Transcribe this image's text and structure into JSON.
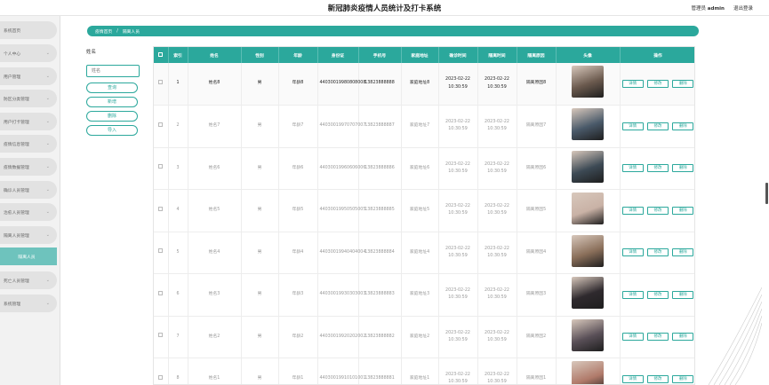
{
  "header": {
    "title": "新冠肺炎疫情人员统计及打卡系统",
    "user_label": "管理员",
    "user_name": "admin",
    "logout": "退出登录"
  },
  "sidebar": {
    "items": [
      {
        "label": "系统首页",
        "chevron": false
      },
      {
        "label": "个人中心",
        "chevron": true
      },
      {
        "label": "用户管理",
        "chevron": true
      },
      {
        "label": "防区分类管理",
        "chevron": true
      },
      {
        "label": "用户打卡管理",
        "chevron": true
      },
      {
        "label": "疫情信息管理",
        "chevron": true
      },
      {
        "label": "疫情数据管理",
        "chevron": true
      },
      {
        "label": "确诊人员管理",
        "chevron": true
      },
      {
        "label": "治愈人员管理",
        "chevron": true
      },
      {
        "label": "隔离人员管理",
        "chevron": true
      },
      {
        "label": "隔离人员",
        "chevron": false,
        "active": true
      },
      {
        "label": "死亡人员管理",
        "chevron": true
      },
      {
        "label": "系统管理",
        "chevron": true
      }
    ]
  },
  "breadcrumb": {
    "home": "疫情首页",
    "separator": "/",
    "current": "隔离人员"
  },
  "search": {
    "label": "姓名",
    "placeholder": "姓名",
    "buttons": [
      "查询",
      "新增",
      "删除",
      "导入"
    ]
  },
  "table": {
    "headers": [
      "索引",
      "姓名",
      "性别",
      "年龄",
      "身份证",
      "手机号",
      "家庭地址",
      "确诊时间",
      "隔离时间",
      "隔离原因",
      "头像",
      "操作"
    ],
    "row_actions": [
      "详情",
      "修改",
      "删除"
    ],
    "rows": [
      {
        "index": "1",
        "name": "姓名8",
        "gender": "男",
        "age": "年龄8",
        "id": "44030019980808008",
        "phone": "13823888888",
        "address": "家庭地址8",
        "confirm_time": "2023-02-22 10:30:59",
        "isolate_time": "2023-02-22 10:30:59",
        "reason": "隔离原因8",
        "avatar_color": "#6b5a4e"
      },
      {
        "index": "2",
        "name": "姓名7",
        "gender": "男",
        "age": "年龄7",
        "id": "44030019970707007",
        "phone": "13823888887",
        "address": "家庭地址7",
        "confirm_time": "2023-02-22 10:30:59",
        "isolate_time": "2023-02-22 10:30:59",
        "reason": "隔离原因7",
        "avatar_color": "#4a5a6a"
      },
      {
        "index": "3",
        "name": "姓名6",
        "gender": "男",
        "age": "年龄6",
        "id": "44030019960606006",
        "phone": "13823888886",
        "address": "家庭地址6",
        "confirm_time": "2023-02-22 10:30:59",
        "isolate_time": "2023-02-22 10:30:59",
        "reason": "隔离原因6",
        "avatar_color": "#3d4a55"
      },
      {
        "index": "4",
        "name": "姓名5",
        "gender": "男",
        "age": "年龄5",
        "id": "44030019950505005",
        "phone": "13823888885",
        "address": "家庭地址5",
        "confirm_time": "2023-02-22 10:30:59",
        "isolate_time": "2023-02-22 10:30:59",
        "reason": "隔离原因5",
        "avatar_color": "#c9b2a6"
      },
      {
        "index": "5",
        "name": "姓名4",
        "gender": "男",
        "age": "年龄4",
        "id": "44030019940404004",
        "phone": "13823888884",
        "address": "家庭地址4",
        "confirm_time": "2023-02-22 10:30:59",
        "isolate_time": "2023-02-22 10:30:59",
        "reason": "隔离原因4",
        "avatar_color": "#8a6f5a"
      },
      {
        "index": "6",
        "name": "姓名3",
        "gender": "男",
        "age": "年龄3",
        "id": "44030019930303003",
        "phone": "13823888883",
        "address": "家庭地址3",
        "confirm_time": "2023-02-22 10:30:59",
        "isolate_time": "2023-02-22 10:30:59",
        "reason": "隔离原因3",
        "avatar_color": "#2f2a2e"
      },
      {
        "index": "7",
        "name": "姓名2",
        "gender": "男",
        "age": "年龄2",
        "id": "44030019920202002",
        "phone": "13823888882",
        "address": "家庭地址2",
        "confirm_time": "2023-02-22 10:30:59",
        "isolate_time": "2023-02-22 10:30:59",
        "reason": "隔离原因2",
        "avatar_color": "#5a5058"
      },
      {
        "index": "8",
        "name": "姓名1",
        "gender": "男",
        "age": "年龄1",
        "id": "44030019910101001",
        "phone": "13823888881",
        "address": "家庭地址1",
        "confirm_time": "2023-02-22 10:30:59",
        "isolate_time": "2023-02-22 10:30:59",
        "reason": "隔离原因1",
        "avatar_color": "#b07a6a"
      }
    ]
  }
}
